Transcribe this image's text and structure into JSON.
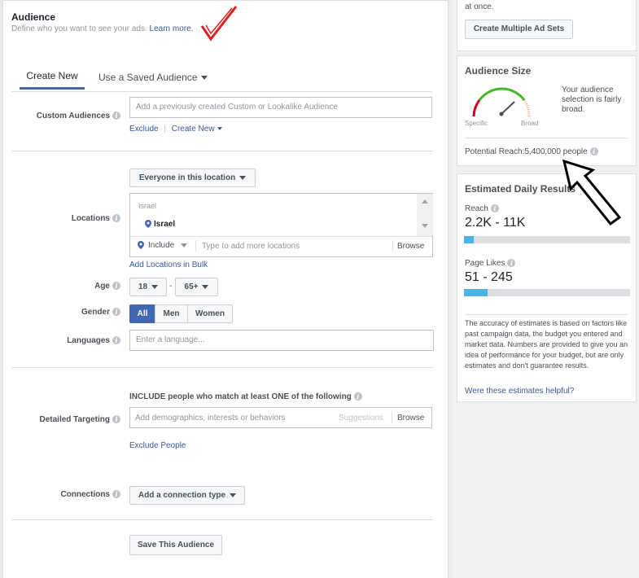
{
  "audience": {
    "title": "Audience",
    "subtitle": "Define who you want to see your ads.",
    "learn_more": "Learn more.",
    "tabs": [
      {
        "label": "Create New",
        "active": true
      },
      {
        "label": "Use a Saved Audience",
        "active": false
      }
    ],
    "custom_audiences": {
      "label": "Custom Audiences",
      "placeholder": "Add a previously created Custom or Lookalike Audience",
      "exclude": "Exclude",
      "create_new": "Create New"
    },
    "locations": {
      "label": "Locations",
      "dropdown": "Everyone in this location",
      "group_header": "Israel",
      "selected": "Israel",
      "include": "Include",
      "placeholder": "Type to add more locations",
      "browse": "Browse",
      "add_bulk": "Add Locations in Bulk"
    },
    "age": {
      "label": "Age",
      "min": "18",
      "separator": "-",
      "max": "65+"
    },
    "gender": {
      "label": "Gender",
      "options": [
        "All",
        "Men",
        "Women"
      ],
      "selected": "All"
    },
    "languages": {
      "label": "Languages",
      "placeholder": "Enter a language..."
    },
    "detailed_targeting": {
      "label": "Detailed Targeting",
      "include_text": "INCLUDE people who match at least ONE of the following",
      "placeholder": "Add demographics, interests or behaviors",
      "suggestions": "Suggestions",
      "browse": "Browse",
      "exclude_people": "Exclude People"
    },
    "connections": {
      "label": "Connections",
      "dropdown": "Add a connection type"
    },
    "save_button": "Save This Audience"
  },
  "sidebar": {
    "top_text": "at once.",
    "create_multiple": "Create Multiple Ad Sets",
    "audience_size": {
      "title": "Audience Size",
      "description": "Your audience selection is fairly broad.",
      "specific": "Specific",
      "broad": "Broad",
      "potential_reach_label": "Potential Reach:",
      "potential_reach_value": "5,400,000 people"
    },
    "estimated": {
      "title": "Estimated Daily Results",
      "reach_label": "Reach",
      "reach_value": "2.2K - 11K",
      "reach_fill": 0.06,
      "likes_label": "Page Likes",
      "likes_value": "51 - 245",
      "likes_fill": 0.14,
      "disclaimer": "The accuracy of estimates is based on factors like past campaign data, the budget you entered and market data. Numbers are provided to give you an idea of performance for your budget, but are only estimates and don't guarantee results.",
      "helpful": "Were these estimates helpful?"
    }
  },
  "colors": {
    "accent": "#4267b2",
    "link": "#365899",
    "bar_fill": "#4cb5e6",
    "annotation_red": "#e02020"
  }
}
